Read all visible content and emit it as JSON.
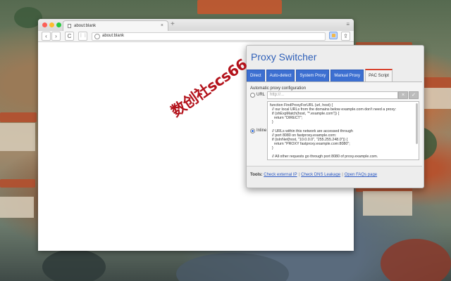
{
  "browser": {
    "tab_title": "about:blank",
    "tab_close": "×",
    "new_tab": "+",
    "menu": "≡",
    "back": "‹",
    "forward": "›",
    "reload": "C",
    "apps": "⋮⋮",
    "address": "about:blank",
    "share": "⇪"
  },
  "popup": {
    "title": "Proxy Switcher",
    "tabs": [
      {
        "label": "Direct"
      },
      {
        "label": "Auto-detect"
      },
      {
        "label": "System Proxy"
      },
      {
        "label": "Manual Proxy"
      },
      {
        "label": "PAC Script",
        "active": true
      }
    ],
    "section_label": "Automatic proxy configuration",
    "url_option": "URL",
    "url_placeholder": "http://...",
    "clear_btn": "×",
    "apply_btn": "✓",
    "inline_option": "Inline",
    "inline_script": "function FindProxyForURL (url, host) {\n  // our local URLs from the domains below example.com don't need a proxy:\n  if (shExpMatch(host, \"*.example.com\")) {\n    return \"DIRECT\";\n  }\n\n  // URLs within this network are accessed through\n  // port 8080 on fastproxy.example.com:\n  if (isInNet(host, \"10.0.0.0\", \"255.255.248.0\")) {\n    return \"PROXY fastproxy.example.com:8080\";\n  }\n\n  // All other requests go through port 8080 of proxy.example.com.",
    "tools_label": "Tools:",
    "tools": [
      "Check external IP",
      "Check DNS Leakage",
      "Open FAQs page"
    ],
    "tools_sep": "|"
  },
  "watermark": "数创社scs66",
  "colors": {
    "accent": "#2e5fb8",
    "tab_blue": "#3c6fd1",
    "active_tab_bar": "#d8412c",
    "watermark": "#b3121b"
  }
}
